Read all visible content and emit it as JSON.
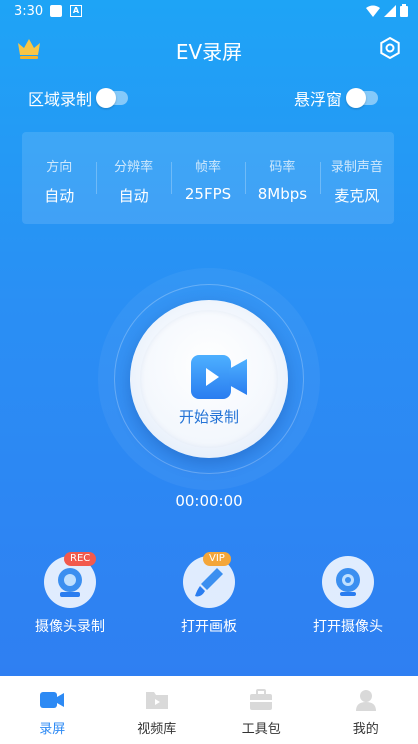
{
  "status": {
    "time": "3:30",
    "a_label": "A"
  },
  "header": {
    "title": "EV录屏"
  },
  "toggles": {
    "area_record": "区域录制",
    "float_window": "悬浮窗"
  },
  "settings": [
    {
      "label": "方向",
      "value": "自动"
    },
    {
      "label": "分辨率",
      "value": "自动"
    },
    {
      "label": "帧率",
      "value": "25FPS"
    },
    {
      "label": "码率",
      "value": "8Mbps"
    },
    {
      "label": "录制声音",
      "value": "麦克风"
    }
  ],
  "record": {
    "label": "开始录制",
    "timer": "00:00:00"
  },
  "tools": [
    {
      "label": "摄像头录制",
      "badge": "REC"
    },
    {
      "label": "打开画板",
      "badge": "VIP"
    },
    {
      "label": "打开摄像头"
    }
  ],
  "nav": [
    {
      "label": "录屏"
    },
    {
      "label": "视频库"
    },
    {
      "label": "工具包"
    },
    {
      "label": "我的"
    }
  ],
  "colors": {
    "accent": "#2d8af4",
    "bg_top": "#1ea4f6",
    "bg_bottom": "#2f7ff2",
    "rec_badge": "#f25a4d",
    "vip_badge": "#f4a63a"
  }
}
